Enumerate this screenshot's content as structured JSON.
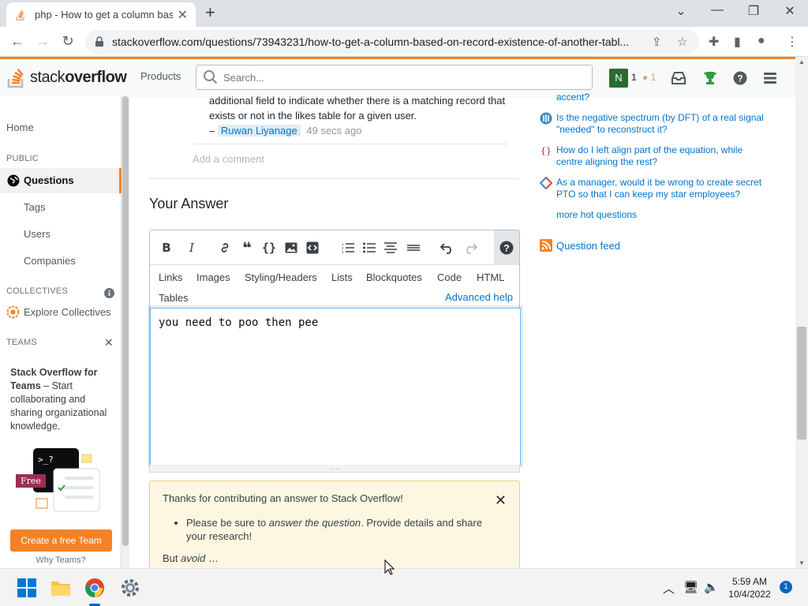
{
  "browser": {
    "tab_title": "php - How to get a column base",
    "tab_close": "✕",
    "new_tab": "+",
    "url": "stackoverflow.com/questions/73943231/how-to-get-a-column-based-on-record-existence-of-another-tabl..."
  },
  "so_header": {
    "logo_plain": "stack",
    "logo_bold": "overflow",
    "products": "Products",
    "search_placeholder": "Search...",
    "avatar_letter": "N",
    "reputation": "1",
    "bronze_badges": "1"
  },
  "left_nav": {
    "home": "Home",
    "public_section": "PUBLIC",
    "questions": "Questions",
    "tags": "Tags",
    "users": "Users",
    "companies": "Companies",
    "collectives_section": "COLLECTIVES",
    "explore_collectives": "Explore Collectives",
    "teams_section": "TEAMS",
    "teams_title": "Stack Overflow for Teams",
    "teams_body": " – Start collaborating and sharing organizational knowledge.",
    "free_badge": "Free",
    "create_team": "Create a free Team",
    "why_teams": "Why Teams?"
  },
  "comment": {
    "text": "additional field to indicate whether there is a matching record that exists or not in the likes table for a given user.",
    "dash": "–",
    "user": "Ruwan Liyanage",
    "time": "49 secs ago",
    "add_comment": "Add a comment"
  },
  "answer": {
    "heading": "Your Answer",
    "help_tabs": [
      "Links",
      "Images",
      "Styling/Headers",
      "Lists",
      "Blockquotes",
      "Code",
      "HTML",
      "Tables"
    ],
    "advanced_help": "Advanced help",
    "body": "you need to poo then pee",
    "grip": "....."
  },
  "notice": {
    "intro": "Thanks for contributing an answer to Stack Overflow!",
    "bullet_pre": "Please be sure to ",
    "bullet_em": "answer the question",
    "bullet_post": ". Provide details and share your research!",
    "avoid_pre": "But ",
    "avoid_em": "avoid",
    "avoid_post": " …",
    "close": "✕"
  },
  "right_sidebar": {
    "partial_top": "accent?",
    "hot_questions": [
      {
        "icon": "dsp-se-icon",
        "text": "Is the negative spectrum (by DFT) of a real signal \"needed\" to reconstruct it?"
      },
      {
        "icon": "tex-se-icon",
        "text": "How do I left align part of the equation, while centre aligning the rest?"
      },
      {
        "icon": "workplace-se-icon",
        "text": "As a manager, would it be wrong to create secret PTO so that I can keep my star employees?"
      }
    ],
    "more_hot": "more hot questions",
    "feed": "Question feed"
  },
  "taskbar": {
    "time": "5:59 AM",
    "date": "10/4/2022",
    "notifications": "1"
  },
  "colors": {
    "so_orange": "#f48225",
    "link_blue": "#0074cc",
    "notice_bg": "#fdf7e2"
  }
}
